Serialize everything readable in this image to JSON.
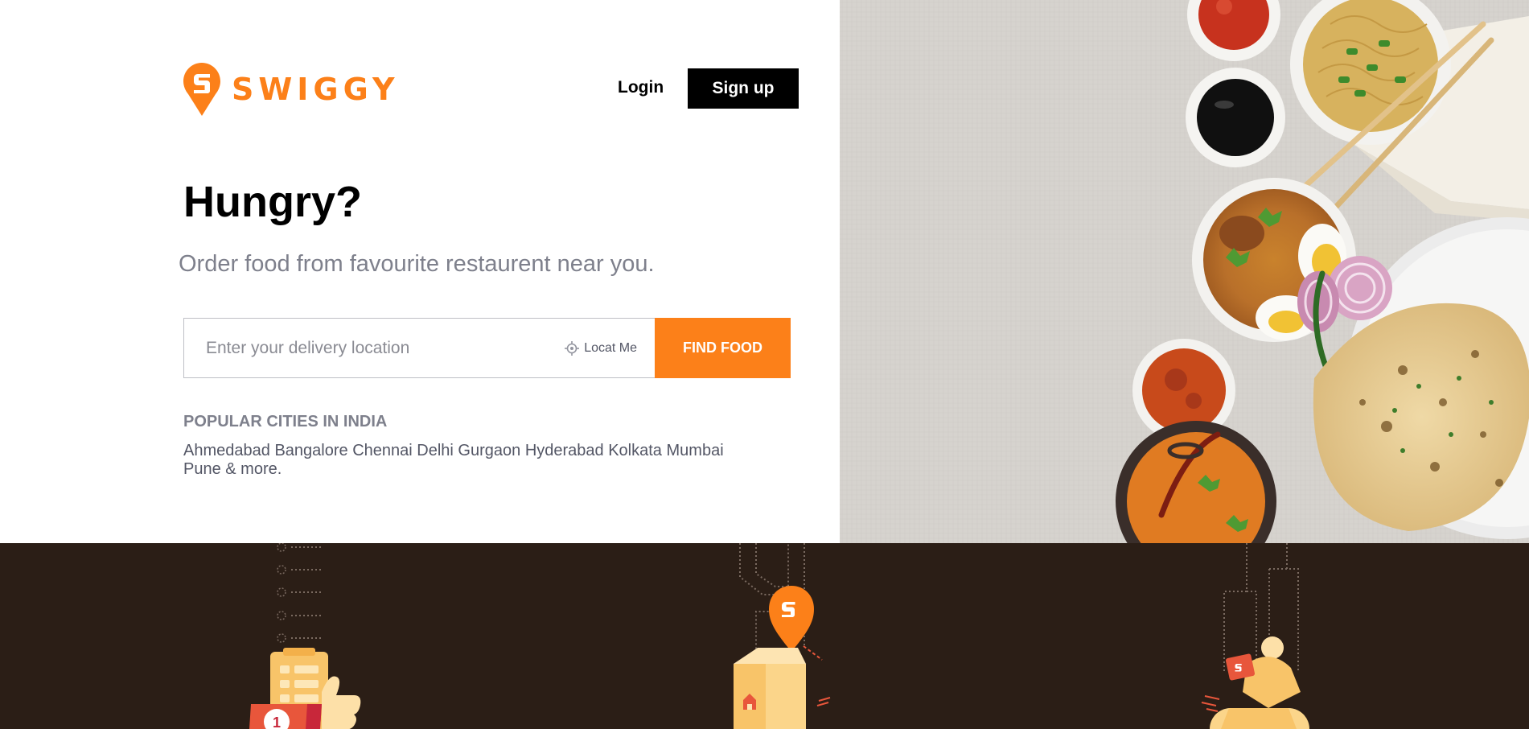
{
  "brand": {
    "name": "SWIGGY",
    "color": "#fc8019"
  },
  "header": {
    "login_label": "Login",
    "signup_label": "Sign up"
  },
  "hero": {
    "headline": "Hungry?",
    "subhead": "Order food from favourite restaurent near you."
  },
  "search": {
    "placeholder": "Enter your delivery location",
    "value": "",
    "locate_label": "Locat Me",
    "locate_icon": "crosshair-icon",
    "find_label": "FIND FOOD"
  },
  "popular": {
    "title": "POPULAR CITIES IN INDIA",
    "cities": [
      "Ahmedabad",
      "Bangalore",
      "Chennai",
      "Delhi",
      "Gurgaon",
      "Hyderabad",
      "Kolkata",
      "Mumbai",
      "Pune"
    ],
    "more_label": "& more."
  },
  "features": [
    {
      "icon": "order-checklist-thumbs-up-icon",
      "step_number": "1"
    },
    {
      "icon": "swiggy-location-pin-map-icon"
    },
    {
      "icon": "delivery-rider-icon"
    }
  ],
  "colors": {
    "accent": "#fc8019",
    "band_background": "#2b1e16",
    "signup_background": "#000000"
  }
}
